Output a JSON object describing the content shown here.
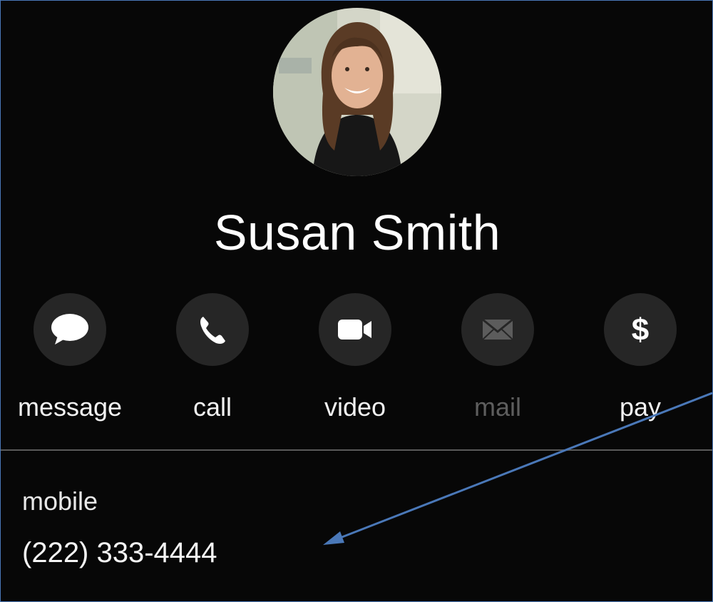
{
  "contact": {
    "name": "Susan Smith"
  },
  "actions": [
    {
      "label": "message",
      "icon": "message-bubble-icon",
      "enabled": true
    },
    {
      "label": "call",
      "icon": "phone-icon",
      "enabled": true
    },
    {
      "label": "video",
      "icon": "video-camera-icon",
      "enabled": true
    },
    {
      "label": "mail",
      "icon": "envelope-icon",
      "enabled": false
    },
    {
      "label": "pay",
      "icon": "dollar-icon",
      "enabled": true
    }
  ],
  "phone": {
    "label": "mobile",
    "number": "(222) 333-4444"
  },
  "colors": {
    "background": "#070707",
    "button_fill": "#262626",
    "text": "#ffffff",
    "disabled_text": "#5e5e5e",
    "annotation_arrow": "#4a78b8"
  }
}
